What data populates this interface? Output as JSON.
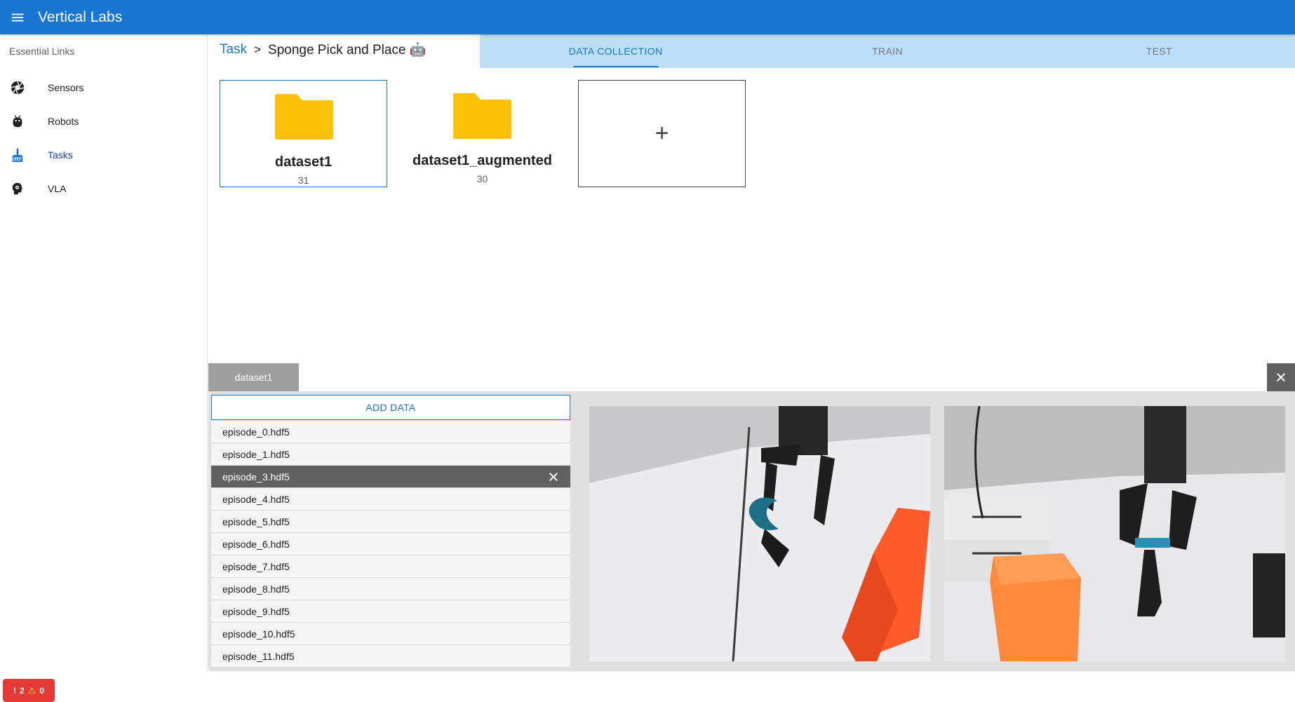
{
  "app": {
    "title": "Vertical Labs"
  },
  "drawer": {
    "header": "Essential Links",
    "items": [
      {
        "label": "Sensors",
        "icon": "camera-aperture-icon"
      },
      {
        "label": "Robots",
        "icon": "robot-icon"
      },
      {
        "label": "Tasks",
        "icon": "broom-icon",
        "active": true
      },
      {
        "label": "VLA",
        "icon": "head-gear-icon"
      }
    ]
  },
  "breadcrumb": {
    "parent": "Task",
    "separator": ">",
    "current": "Sponge Pick and Place 🤖"
  },
  "tabs": [
    {
      "label": "DATA COLLECTION",
      "active": true
    },
    {
      "label": "TRAIN"
    },
    {
      "label": "TEST"
    }
  ],
  "datasets": [
    {
      "name": "dataset1",
      "count": "31",
      "selected": true
    },
    {
      "name": "dataset1_augmented",
      "count": "30"
    }
  ],
  "add_dataset_symbol": "+",
  "panel": {
    "tab_label": "dataset1",
    "add_data_label": "ADD DATA",
    "episodes": [
      "episode_0.hdf5",
      "episode_1.hdf5",
      "episode_3.hdf5",
      "episode_4.hdf5",
      "episode_5.hdf5",
      "episode_6.hdf5",
      "episode_7.hdf5",
      "episode_8.hdf5",
      "episode_9.hdf5",
      "episode_10.hdf5",
      "episode_11.hdf5"
    ],
    "selected_episode": "episode_3.hdf5"
  },
  "status_badge": {
    "errors": "2",
    "warnings": "0"
  },
  "colors": {
    "primary": "#1976d2",
    "tab_bar": "#bbdefb",
    "folder": "#ffc107",
    "error": "#e53935"
  }
}
